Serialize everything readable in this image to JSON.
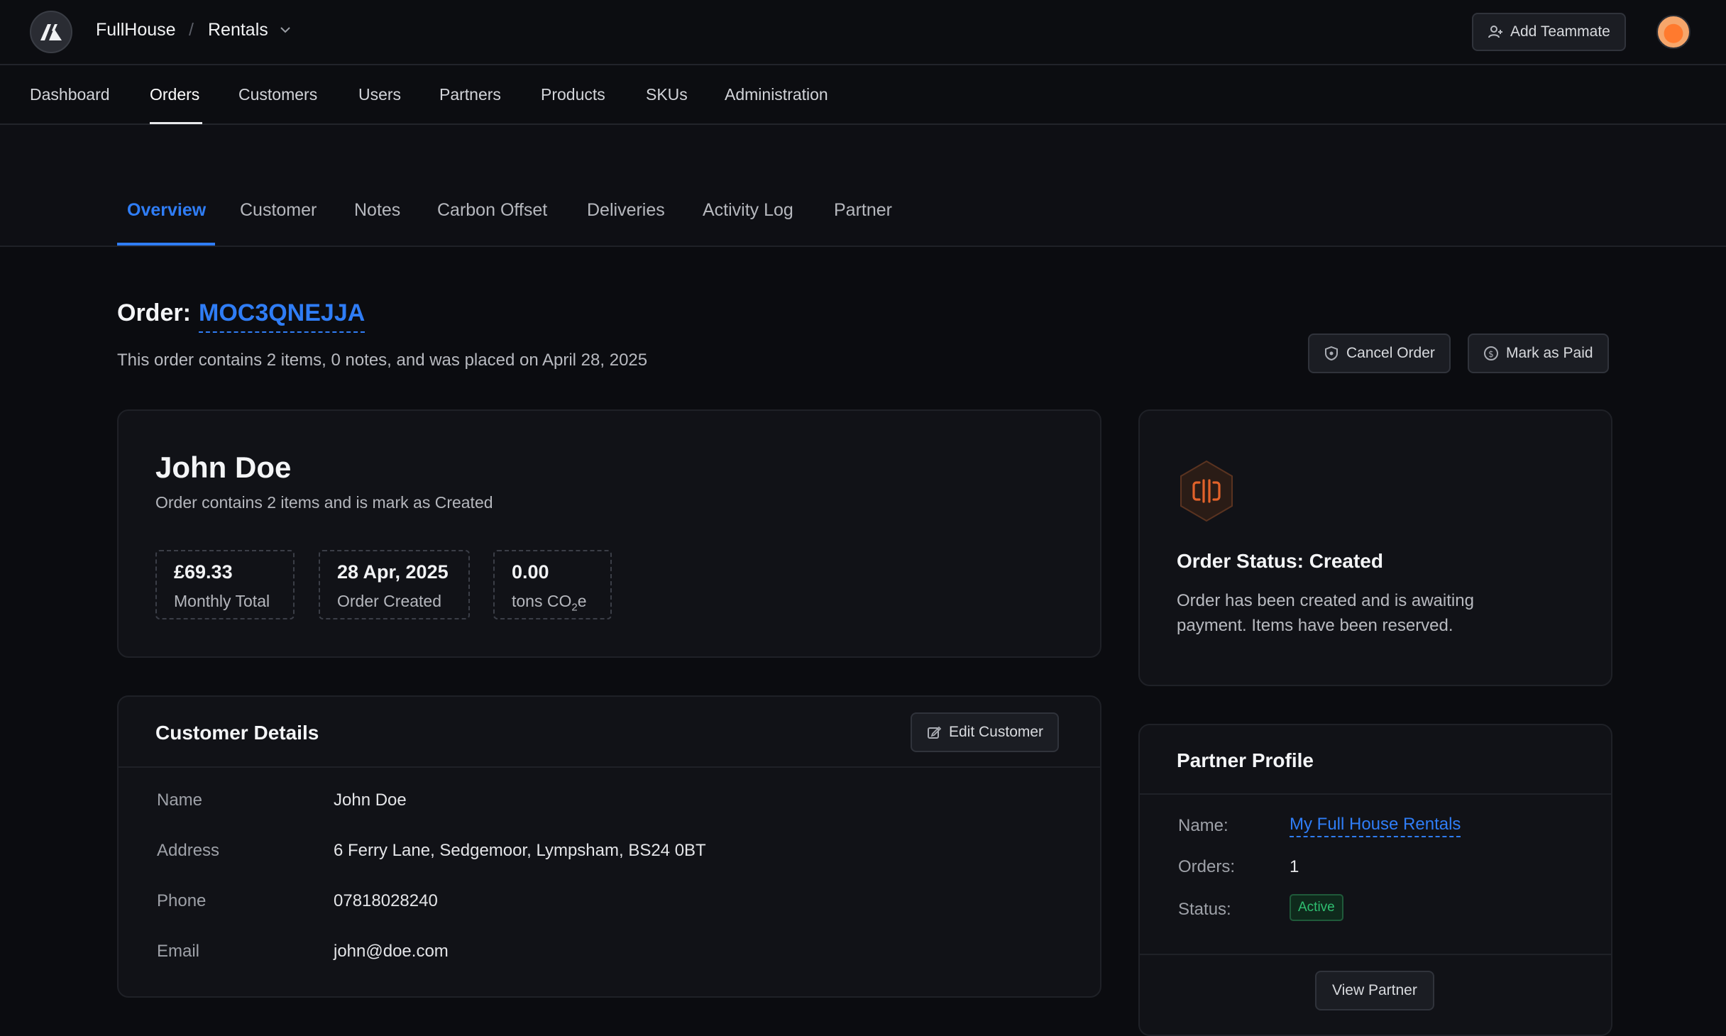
{
  "topbar": {
    "org": "FullHouse",
    "separator": "/",
    "project": "Rentals",
    "add_teammate_label": "Add Teammate"
  },
  "nav": {
    "items": [
      "Dashboard",
      "Orders",
      "Customers",
      "Users",
      "Partners",
      "Products",
      "SKUs",
      "Administration"
    ],
    "active": "Orders"
  },
  "tabs": {
    "items": [
      "Overview",
      "Customer",
      "Notes",
      "Carbon Offset",
      "Deliveries",
      "Activity Log",
      "Partner"
    ],
    "active": "Overview"
  },
  "order": {
    "title_prefix": "Order:",
    "id": "MOC3QNEJJA",
    "summary": "This order contains 2 items, 0 notes, and was placed on April 28, 2025",
    "cancel_label": "Cancel Order",
    "mark_paid_label": "Mark as Paid"
  },
  "summary_card": {
    "name": "John Doe",
    "subtitle": "Order contains 2 items and is mark as Created",
    "stats": [
      {
        "value": "£69.33",
        "label": "Monthly Total"
      },
      {
        "value": "28 Apr, 2025",
        "label": "Order Created"
      },
      {
        "value": "0.00",
        "label_prefix": "tons CO",
        "label_sub": "2",
        "label_suffix": "e"
      }
    ]
  },
  "customer_details": {
    "title": "Customer Details",
    "edit_label": "Edit Customer",
    "rows": [
      {
        "label": "Name",
        "value": "John Doe"
      },
      {
        "label": "Address",
        "value": "6 Ferry Lane, Sedgemoor, Lympsham, BS24 0BT"
      },
      {
        "label": "Phone",
        "value": "07818028240"
      },
      {
        "label": "Email",
        "value": "john@doe.com"
      }
    ]
  },
  "status_card": {
    "title": "Order Status: Created",
    "description": "Order has been created and is awaiting payment. Items have been reserved."
  },
  "partner_profile": {
    "title": "Partner Profile",
    "name_label": "Name:",
    "name_value": "My Full House Rentals",
    "orders_label": "Orders:",
    "orders_value": "1",
    "status_label": "Status:",
    "status_value": "Active",
    "view_label": "View Partner"
  },
  "colors": {
    "accent": "#2f7df6",
    "status_active": "#2fbf71",
    "status_icon": "#e2622a"
  }
}
